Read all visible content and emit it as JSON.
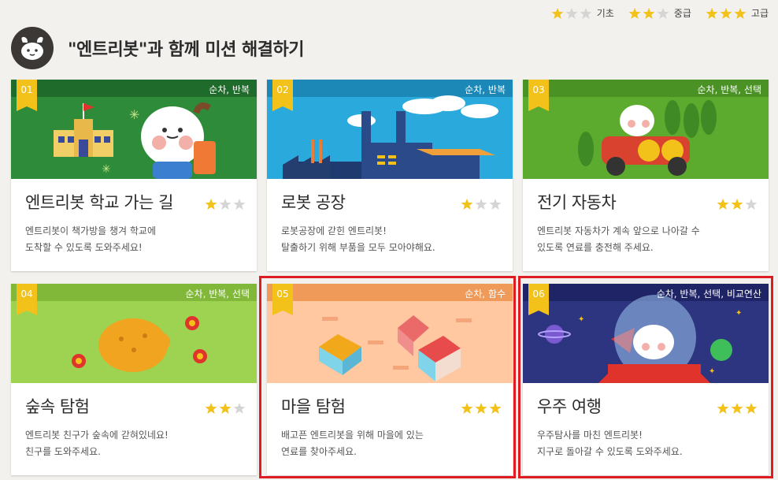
{
  "legend": [
    {
      "label": "기초",
      "level": 1
    },
    {
      "label": "중급",
      "level": 2
    },
    {
      "label": "고급",
      "level": 3
    }
  ],
  "header": {
    "title": "\"엔트리봇\"과 함께 미션 해결하기"
  },
  "colors": {
    "star_on": "#f2c21b",
    "star_off": "#d5d5d5",
    "highlight": "#e01c23"
  },
  "cards": [
    {
      "number": "01",
      "tags": "순차, 반복",
      "title": "엔트리봇 학교 가는 길",
      "desc1": "엔트리봇이 책가방을 챙겨 학교에",
      "desc2": "도착할 수 있도록 도와주세요!",
      "level": 1
    },
    {
      "number": "02",
      "tags": "순차, 반복",
      "title": "로봇 공장",
      "desc1": "로봇공장에 갇힌 엔트리봇!",
      "desc2": "탈출하기 위해 부품을 모두 모아야해요.",
      "level": 1
    },
    {
      "number": "03",
      "tags": "순차, 반복, 선택",
      "title": "전기 자동차",
      "desc1": "엔트리봇 자동차가 계속 앞으로 나아갈 수",
      "desc2": "있도록 연료를 충전해 주세요.",
      "level": 2
    },
    {
      "number": "04",
      "tags": "순차, 반복, 선택",
      "title": "숲속 탐험",
      "desc1": "엔트리봇 친구가 숲속에 갇혀있네요!",
      "desc2": "친구를 도와주세요.",
      "level": 2
    },
    {
      "number": "05",
      "tags": "순차, 함수",
      "title": "마을 탐험",
      "desc1": "배고픈 엔트리봇을 위해 마을에 있는",
      "desc2": "연료를 찾아주세요.",
      "level": 3
    },
    {
      "number": "06",
      "tags": "순차, 반복, 선택, 비교연산",
      "title": "우주 여행",
      "desc1": "우주탐사를 마친 엔트리봇!",
      "desc2": "지구로 돌아갈 수 있도록 도와주세요.",
      "level": 3
    }
  ]
}
